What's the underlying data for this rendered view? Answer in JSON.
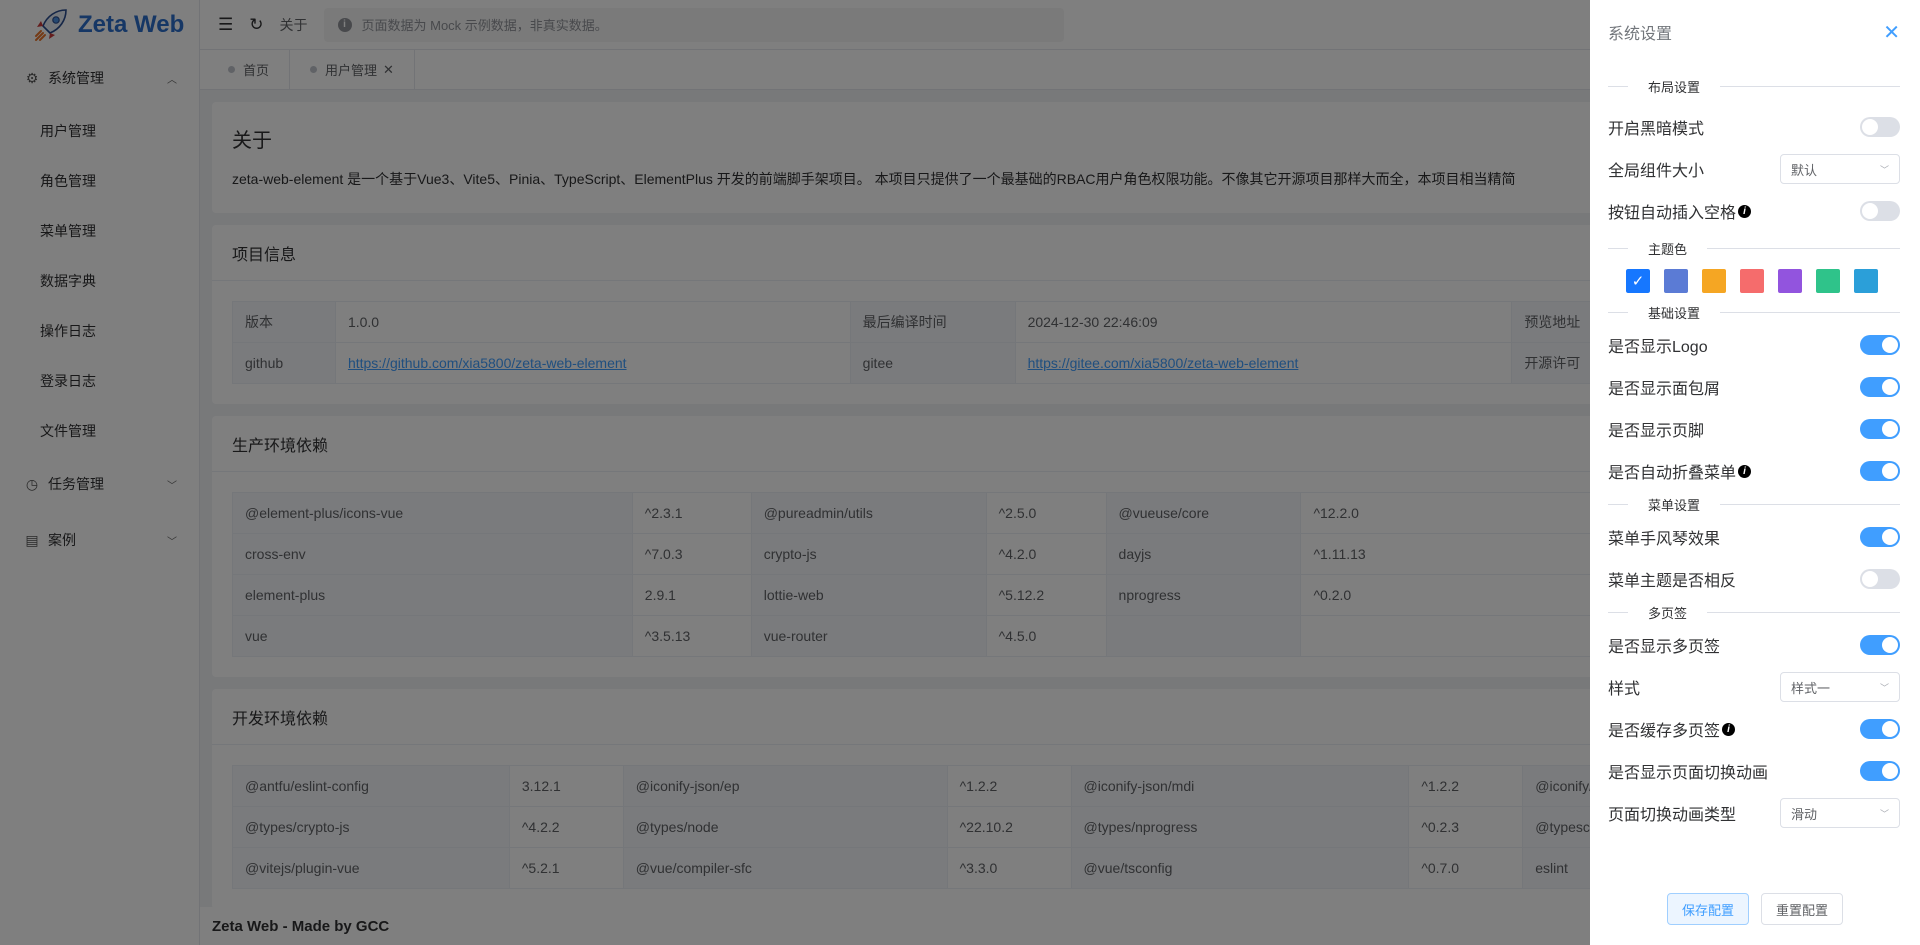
{
  "app": {
    "title": "Zeta Web"
  },
  "sidebar": {
    "groups": [
      {
        "label": "系统管理",
        "expanded": true,
        "items": [
          "用户管理",
          "角色管理",
          "菜单管理",
          "数据字典",
          "操作日志",
          "登录日志",
          "文件管理"
        ]
      },
      {
        "label": "任务管理",
        "expanded": false
      },
      {
        "label": "案例",
        "expanded": false
      }
    ]
  },
  "topbar": {
    "breadcrumb": "关于",
    "notice": "页面数据为 Mock 示例数据，非真实数据。"
  },
  "tags": [
    {
      "label": "首页"
    },
    {
      "label": "用户管理"
    }
  ],
  "about": {
    "title": "关于",
    "description": "zeta-web-element 是一个基于Vue3、Vite5、Pinia、TypeScript、ElementPlus 开发的前端脚手架项目。 本项目只提供了一个最基础的RBAC用户角色权限功能。不像其它开源项目那样大而全，本项目相当精简"
  },
  "project": {
    "title": "项目信息",
    "rows": [
      [
        {
          "label": "版本"
        },
        {
          "value": "1.0.0"
        },
        {
          "label": "最后编译时间"
        },
        {
          "value": "2024-12-30 22:46:09"
        },
        {
          "label": "预览地址"
        }
      ],
      [
        {
          "label": "github"
        },
        {
          "link": "https://github.com/xia5800/zeta-web-element"
        },
        {
          "label": "gitee"
        },
        {
          "link": "https://gitee.com/xia5800/zeta-web-element"
        },
        {
          "label": "开源许可"
        }
      ]
    ]
  },
  "prod_deps": {
    "title": "生产环境依赖",
    "rows": [
      [
        "@element-plus/icons-vue",
        "^2.3.1",
        "@pureadmin/utils",
        "^2.5.0",
        "@vueuse/core",
        "^12.2.0"
      ],
      [
        "cross-env",
        "^7.0.3",
        "crypto-js",
        "^4.2.0",
        "dayjs",
        "^1.11.13"
      ],
      [
        "element-plus",
        "2.9.1",
        "lottie-web",
        "^5.12.2",
        "nprogress",
        "^0.2.0"
      ],
      [
        "vue",
        "^3.5.13",
        "vue-router",
        "^4.5.0",
        "",
        ""
      ]
    ]
  },
  "dev_deps": {
    "title": "开发环境依赖",
    "rows": [
      [
        "@antfu/eslint-config",
        "3.12.1",
        "@iconify-json/ep",
        "^1.2.2",
        "@iconify-json/mdi",
        "^1.2.2",
        "@iconify/vu"
      ],
      [
        "@types/crypto-js",
        "^4.2.2",
        "@types/node",
        "^22.10.2",
        "@types/nprogress",
        "^0.2.3",
        "@typescrip"
      ],
      [
        "@vitejs/plugin-vue",
        "^5.2.1",
        "@vue/compiler-sfc",
        "^3.3.0",
        "@vue/tsconfig",
        "^0.7.0",
        "eslint"
      ]
    ]
  },
  "footer": {
    "text": "Zeta Web - Made by GCC"
  },
  "drawer": {
    "title": "系统设置",
    "sections": {
      "layout": "布局设置",
      "theme": "主题色",
      "basic": "基础设置",
      "menu": "菜单设置",
      "tabs": "多页签"
    },
    "layout": [
      {
        "label": "开启黑暗模式",
        "type": "switch",
        "on": false
      },
      {
        "label": "全局组件大小",
        "type": "select",
        "value": "默认"
      },
      {
        "label": "按钮自动插入空格",
        "type": "switch",
        "on": false,
        "tip": true
      }
    ],
    "theme_colors": [
      "#1677ff",
      "#5b7bd5",
      "#f5a623",
      "#f56c6c",
      "#9254de",
      "#2fc38a",
      "#2b9fd9"
    ],
    "theme_selected": 0,
    "basic": [
      {
        "label": "是否显示Logo",
        "type": "switch",
        "on": true
      },
      {
        "label": "是否显示面包屑",
        "type": "switch",
        "on": true
      },
      {
        "label": "是否显示页脚",
        "type": "switch",
        "on": true
      },
      {
        "label": "是否自动折叠菜单",
        "type": "switch",
        "on": true,
        "tip": true
      }
    ],
    "menu": [
      {
        "label": "菜单手风琴效果",
        "type": "switch",
        "on": true
      },
      {
        "label": "菜单主题是否相反",
        "type": "switch",
        "on": false
      }
    ],
    "tabs": [
      {
        "label": "是否显示多页签",
        "type": "switch",
        "on": true
      },
      {
        "label": "样式",
        "type": "select",
        "value": "样式一"
      },
      {
        "label": "是否缓存多页签",
        "type": "switch",
        "on": true,
        "tip": true
      },
      {
        "label": "是否显示页面切换动画",
        "type": "switch",
        "on": true
      },
      {
        "label": "页面切换动画类型",
        "type": "select",
        "value": "滑动"
      }
    ],
    "buttons": {
      "save": "保存配置",
      "reset": "重置配置"
    }
  }
}
